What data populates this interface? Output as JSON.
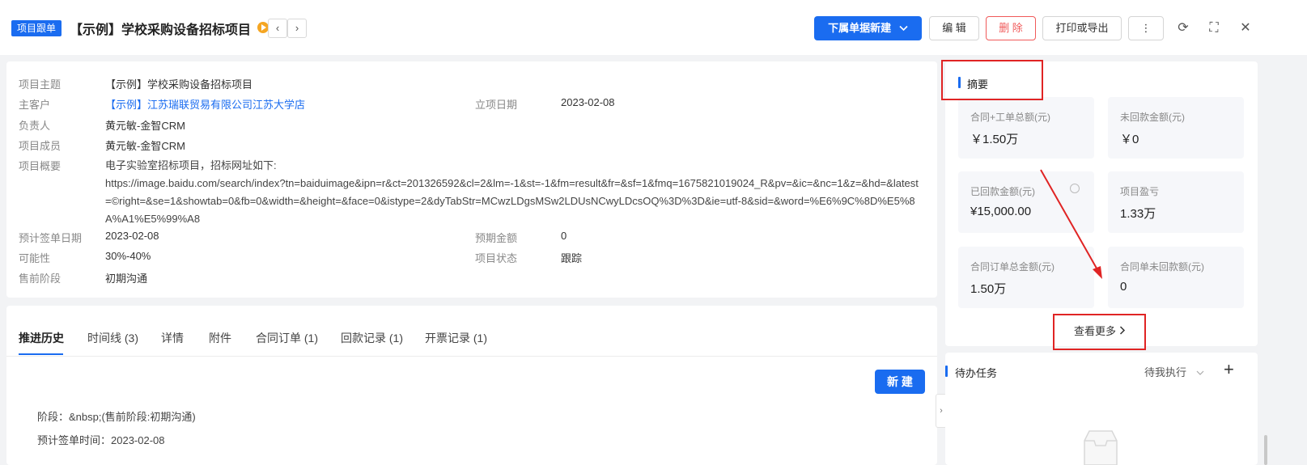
{
  "header": {
    "tag": "项目跟单",
    "title": "【示例】学校采购设备招标项目",
    "prev": "‹",
    "next": "›",
    "sub_create": "下属单据新建",
    "edit": "编 辑",
    "delete": "删 除",
    "print": "打印或导出",
    "more": "⋮",
    "refresh": "⟳",
    "fullscreen": "⛶",
    "close": "✕"
  },
  "details": {
    "subject_label": "项目主题",
    "subject": "【示例】学校采购设备招标项目",
    "customer_label": "主客户",
    "customer": "【示例】江苏瑞联贸易有限公司江苏大学店",
    "start_date_label": "立项日期",
    "start_date": "2023-02-08",
    "owner_label": "负责人",
    "owner": "黄元敏-金智CRM",
    "members_label": "项目成员",
    "members": "黄元敏-金智CRM",
    "overview_label": "项目概要",
    "overview_line1": "电子实验室招标项目，招标网址如下:",
    "overview_url": "https://image.baidu.com/search/index?tn=baiduimage&ipn=r&ct=201326592&cl=2&lm=-1&st=-1&fm=result&fr=&sf=1&fmq=1675821019024_R&pv=&ic=&nc=1&z=&hd=&latest=©right=&se=1&showtab=0&fb=0&width=&height=&face=0&istype=2&dyTabStr=MCwzLDgsMSw2LDUsNCwyLDcsOQ%3D%3D&ie=utf-8&sid=&word=%E6%9C%8D%E5%8A%A1%E5%99%A8",
    "sign_date_label": "预计签单日期",
    "sign_date": "2023-02-08",
    "expected_amount_label": "预期金额",
    "expected_amount": "0",
    "probability_label": "可能性",
    "probability": "30%-40%",
    "status_label": "项目状态",
    "status": "跟踪",
    "stage_label": "售前阶段",
    "stage": "初期沟通"
  },
  "tabs": [
    {
      "label": "推进历史"
    },
    {
      "label": "时间线 (3)"
    },
    {
      "label": "详情"
    },
    {
      "label": "附件"
    },
    {
      "label": "合同订单 (1)"
    },
    {
      "label": "回款记录 (1)"
    },
    {
      "label": "开票记录 (1)"
    }
  ],
  "history": {
    "new_button": "新 建",
    "stage_line": "阶段：&nbsp;(售前阶段:初期沟通)",
    "sign_line": "预计签单时间：2023-02-08"
  },
  "summary": {
    "title": "摘要",
    "tiles": [
      {
        "label": "合同+工单总额(元)",
        "value": "￥1.50万"
      },
      {
        "label": "未回款金额(元)",
        "value": "￥0"
      },
      {
        "label": "已回款金额(元)",
        "value": "¥15,000.00"
      },
      {
        "label": "项目盈亏",
        "value": "1.33万"
      },
      {
        "label": "合同订单总金额(元)",
        "value": "1.50万"
      },
      {
        "label": "合同单未回款额(元)",
        "value": "0"
      }
    ],
    "more": "查看更多"
  },
  "tasks": {
    "title": "待办任务",
    "filter": "待我执行",
    "add": "+"
  },
  "colors": {
    "accent": "#1a6cf0",
    "danger": "#f05a5a",
    "highlight": "#e02424"
  }
}
